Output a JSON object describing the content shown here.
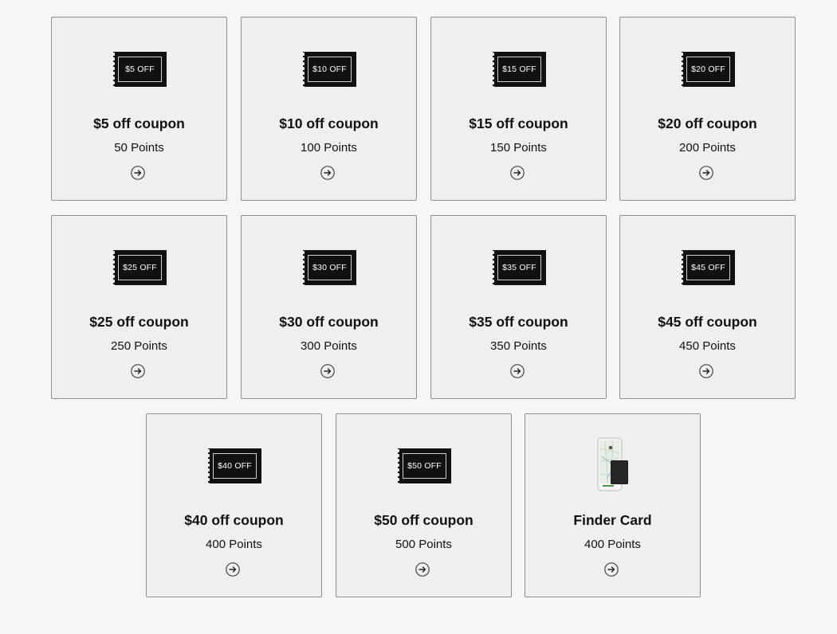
{
  "rewards": [
    {
      "badge": "$5 OFF",
      "title": "$5 off coupon",
      "points": "50 Points",
      "kind": "coupon"
    },
    {
      "badge": "$10 OFF",
      "title": "$10 off coupon",
      "points": "100 Points",
      "kind": "coupon"
    },
    {
      "badge": "$15 OFF",
      "title": "$15 off coupon",
      "points": "150 Points",
      "kind": "coupon"
    },
    {
      "badge": "$20 OFF",
      "title": "$20 off coupon",
      "points": "200 Points",
      "kind": "coupon"
    },
    {
      "badge": "$25 OFF",
      "title": "$25 off coupon",
      "points": "250 Points",
      "kind": "coupon"
    },
    {
      "badge": "$30 OFF",
      "title": "$30 off coupon",
      "points": "300 Points",
      "kind": "coupon"
    },
    {
      "badge": "$35 OFF",
      "title": "$35 off coupon",
      "points": "350 Points",
      "kind": "coupon"
    },
    {
      "badge": "$45 OFF",
      "title": "$45 off coupon",
      "points": "450 Points",
      "kind": "coupon"
    },
    {
      "badge": "$40 OFF",
      "title": "$40 off coupon",
      "points": "400 Points",
      "kind": "coupon"
    },
    {
      "badge": "$50 OFF",
      "title": "$50 off coupon",
      "points": "500 Points",
      "kind": "coupon"
    },
    {
      "badge": "",
      "title": "Finder Card",
      "points": "400 Points",
      "kind": "product",
      "image": "phone-and-finder-card-image"
    }
  ],
  "icons": {
    "arrow": "arrow-right-circle-icon"
  },
  "colors": {
    "card_bg": "#efefef",
    "card_border": "#8f8f8f",
    "coupon_bg": "#111111",
    "page_bg": "#f6f6f6"
  }
}
